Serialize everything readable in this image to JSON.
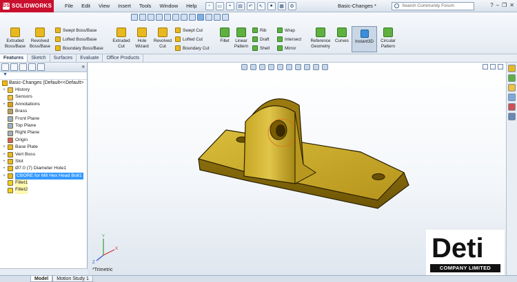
{
  "app": {
    "logo": "SOLIDWORKS",
    "doc_title": "Basic-Changes *"
  },
  "menu": [
    "File",
    "Edit",
    "View",
    "Insert",
    "Tools",
    "Window",
    "Help"
  ],
  "search": {
    "placeholder": "Search Community Forum"
  },
  "commands": {
    "extruded_boss": "Extruded Boss/Base",
    "revolved_boss": "Revolved Boss/Base",
    "swept_boss": "Swept Boss/Base",
    "lofted_boss": "Lofted Boss/Base",
    "boundary_boss": "Boundary Boss/Base",
    "extruded_cut": "Extruded Cut",
    "hole_wizard": "Hole Wizard",
    "revolved_cut": "Revolved Cut",
    "swept_cut": "Swept Cut",
    "lofted_cut": "Lofted Cut",
    "boundary_cut": "Boundary Cut",
    "fillet": "Fillet",
    "linear_pattern": "Linear Pattern",
    "rib": "Rib",
    "draft": "Draft",
    "shell": "Shell",
    "wrap": "Wrap",
    "intersect": "Intersect",
    "mirror": "Mirror",
    "reference_geometry": "Reference Geometry",
    "curves": "Curves",
    "instant3d": "Instant3D",
    "circular_pattern": "Circular Pattern"
  },
  "tabs": [
    "Features",
    "Sketch",
    "Surfaces",
    "Evaluate",
    "Office Products"
  ],
  "tree": {
    "root": "Basic-Changes  (Default<<Default>",
    "items": [
      {
        "label": "History",
        "expand": "+",
        "icon": "folder-icon",
        "state": ""
      },
      {
        "label": "Sensors",
        "expand": "",
        "icon": "folder-icon",
        "state": ""
      },
      {
        "label": "Annotations",
        "expand": "+",
        "icon": "annotation-icon",
        "state": ""
      },
      {
        "label": "Brass",
        "expand": "",
        "icon": "material-icon",
        "state": ""
      },
      {
        "label": "Front Plane",
        "expand": "",
        "icon": "plane-icon",
        "state": ""
      },
      {
        "label": "Top Plane",
        "expand": "",
        "icon": "plane-icon",
        "state": ""
      },
      {
        "label": "Right Plane",
        "expand": "",
        "icon": "plane-icon",
        "state": ""
      },
      {
        "label": "Origin",
        "expand": "",
        "icon": "origin-icon",
        "state": ""
      },
      {
        "label": "Base Plate",
        "expand": "+",
        "icon": "feature-icon",
        "state": ""
      },
      {
        "label": "Vert Boss",
        "expand": "+",
        "icon": "feature-icon",
        "state": ""
      },
      {
        "label": "Slot",
        "expand": "+",
        "icon": "feature-icon",
        "state": ""
      },
      {
        "label": "Ø7.0 (7) Diameter Hole1",
        "expand": "+",
        "icon": "hole-icon",
        "state": ""
      },
      {
        "label": "CBORE for M8 Hex Head Bolt1",
        "expand": "+",
        "icon": "hole-icon",
        "state": "selected"
      },
      {
        "label": "Fillet1",
        "expand": "",
        "icon": "fillet-icon",
        "state": "highlight"
      },
      {
        "label": "Fillet2",
        "expand": "",
        "icon": "fillet-icon",
        "state": "highlight"
      }
    ]
  },
  "viewport": {
    "view_label": "*Trimetric"
  },
  "status_tabs": [
    "Model",
    "Motion Study 1"
  ],
  "watermark": {
    "brand": "Deti",
    "company": "COMPANY LIMITED"
  },
  "colors": {
    "part_gold": "#c9a824",
    "selection_blue": "#3399ff",
    "brand_red": "#c8102e"
  }
}
